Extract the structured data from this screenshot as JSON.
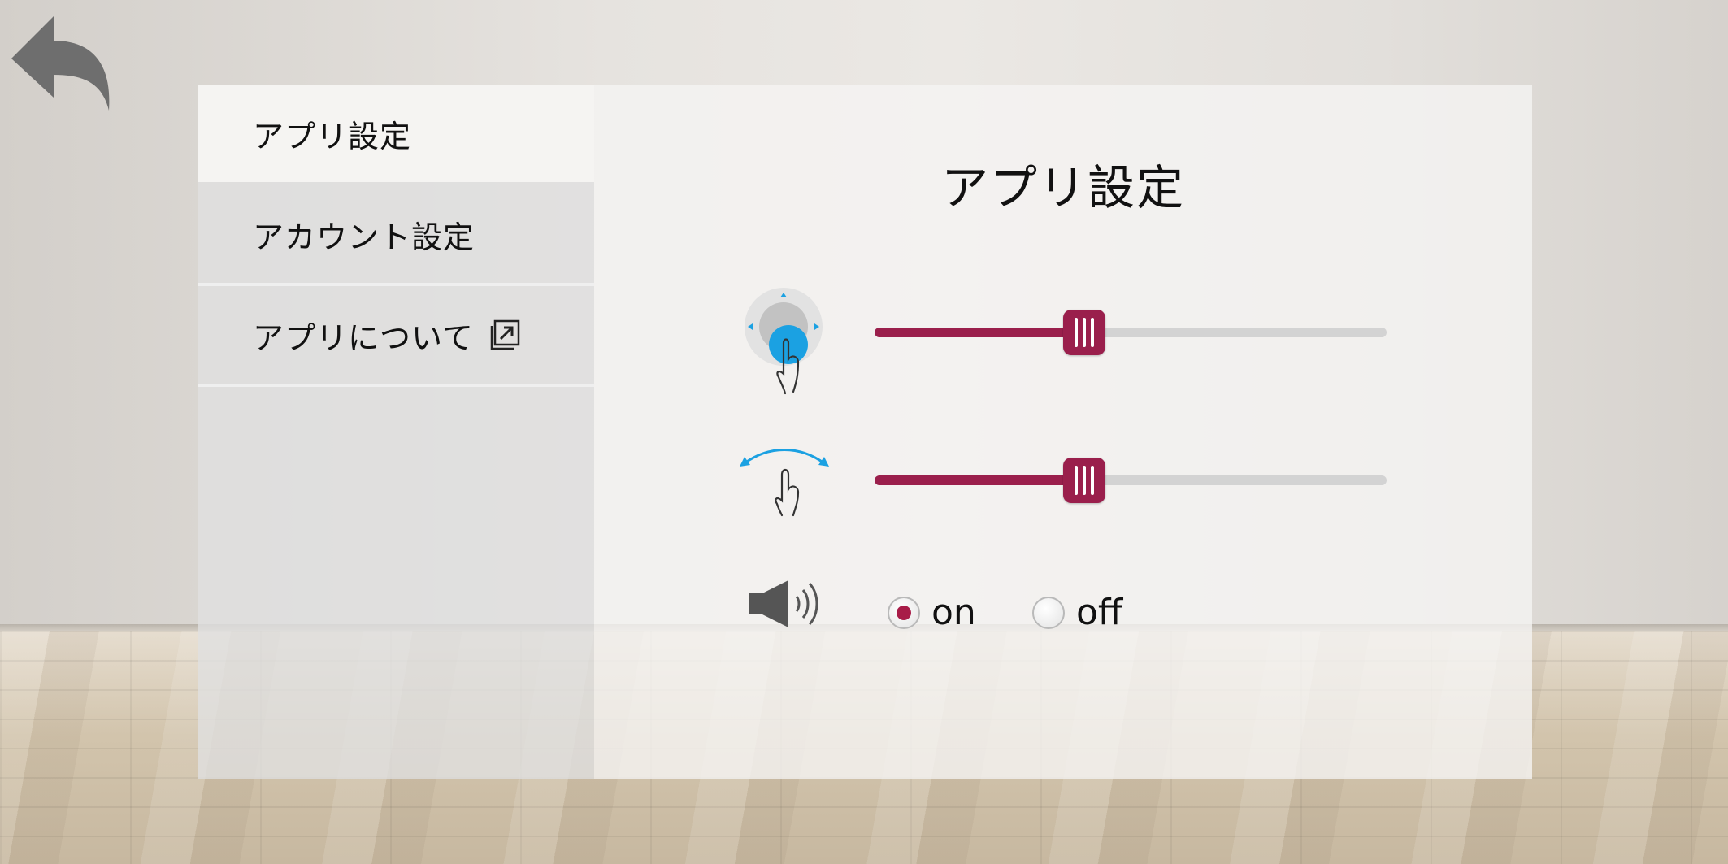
{
  "nav": {
    "items": [
      {
        "label": "アプリ設定",
        "active": true
      },
      {
        "label": "アカウント設定",
        "active": false
      },
      {
        "label": "アプリについて",
        "active": false,
        "icon": "external-link-icon"
      }
    ]
  },
  "main": {
    "title": "アプリ設定",
    "settings": [
      {
        "icon": "joystick-drag-icon",
        "type": "slider",
        "value": 0.41
      },
      {
        "icon": "swipe-gesture-icon",
        "type": "slider",
        "value": 0.41
      },
      {
        "icon": "speaker-icon",
        "type": "radio",
        "options": [
          "on",
          "off"
        ],
        "selected": "on"
      }
    ]
  },
  "colors": {
    "accent": "#9a1f4c",
    "track": "#d3d3d3",
    "icon_blue": "#1ba1e2"
  }
}
